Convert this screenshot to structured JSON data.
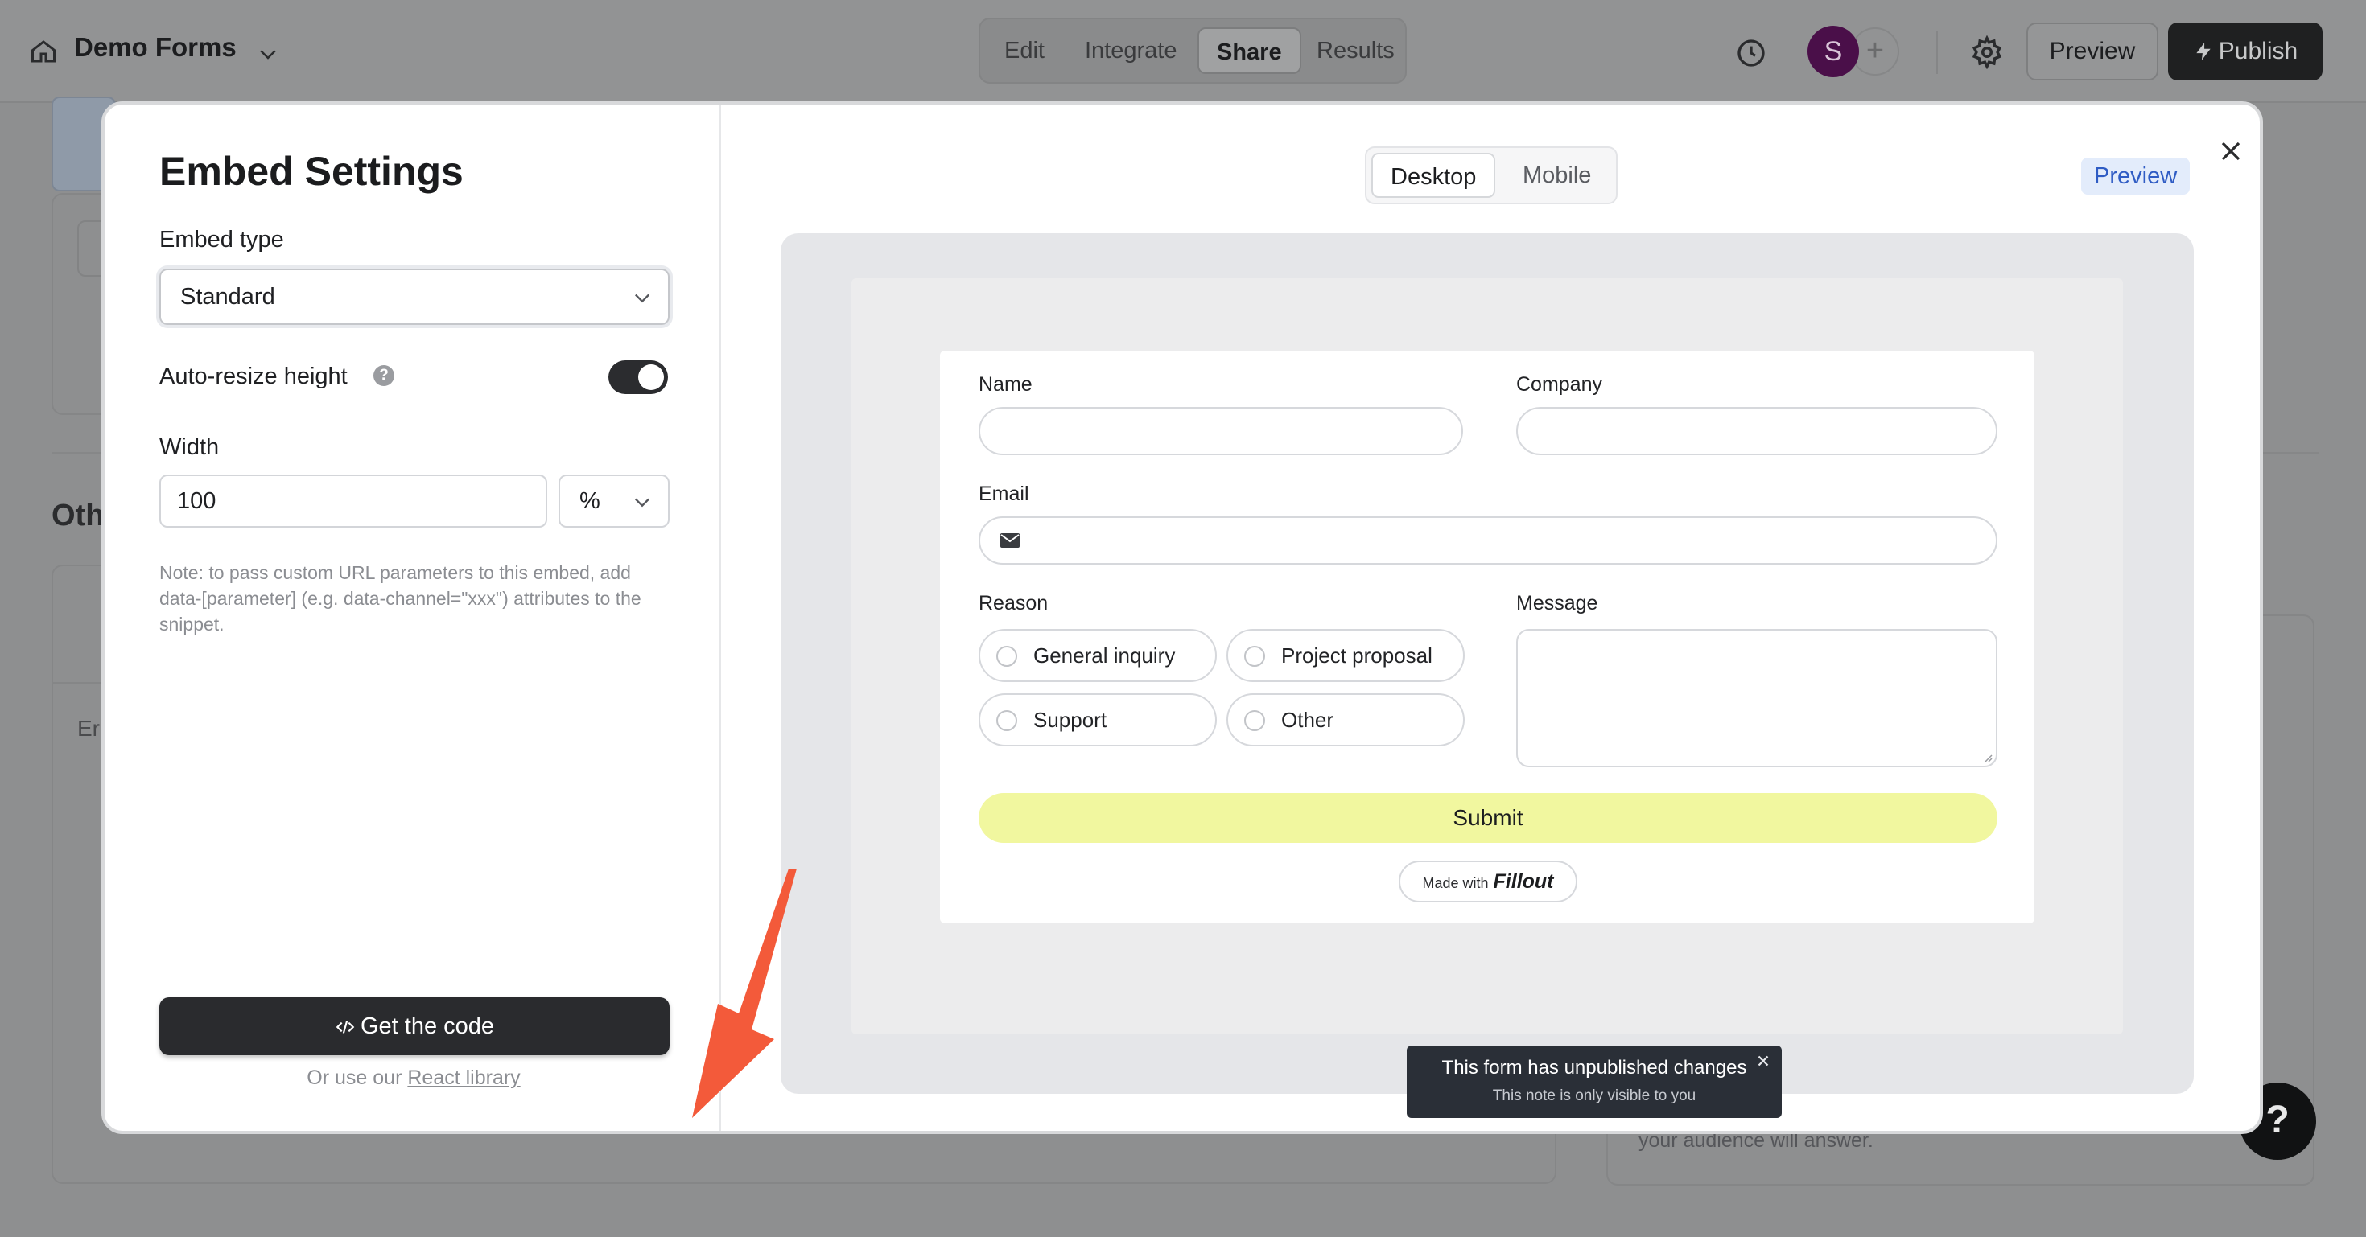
{
  "header": {
    "app_title": "Demo Forms",
    "tabs": [
      {
        "label": "Edit"
      },
      {
        "label": "Integrate"
      },
      {
        "label": "Share",
        "active": true
      },
      {
        "label": "Results"
      }
    ],
    "avatar_initial": "S",
    "add_user_symbol": "+",
    "preview_label": "Preview",
    "publish_label": "Publish",
    "icons": [
      "home-icon",
      "chevron-down-icon",
      "history-icon",
      "gear-icon",
      "lightning-icon"
    ]
  },
  "background": {
    "section_heading": "Oth",
    "card_text_1": "Er",
    "card_text_2": "your audience will answer.",
    "help_symbol": "?"
  },
  "modal": {
    "title": "Embed Settings",
    "embed_type_label": "Embed type",
    "embed_type_value": "Standard",
    "auto_resize_label": "Auto-resize height",
    "auto_resize_on": true,
    "width_label": "Width",
    "width_value": "100",
    "width_unit": "%",
    "note": "Note: to pass custom URL parameters to this embed, add data-[parameter] (e.g. data-channel=\"xxx\") attributes to the snippet.",
    "get_code_label": "Get the code",
    "react_prefix": "Or use our",
    "react_link": "React library",
    "view_tabs": [
      {
        "label": "Desktop",
        "active": true
      },
      {
        "label": "Mobile"
      }
    ],
    "preview_badge": "Preview"
  },
  "form_preview": {
    "name_label": "Name",
    "company_label": "Company",
    "email_label": "Email",
    "reason_label": "Reason",
    "message_label": "Message",
    "reason_options": [
      "General inquiry",
      "Project proposal",
      "Support",
      "Other"
    ],
    "submit_label": "Submit",
    "made_with": "Made with",
    "brand": "Fillout",
    "colors": {
      "submit_bg": "#f1f79f",
      "toast_bg": "#2a2f37",
      "accent_badge": "#2f5cc4"
    }
  },
  "toast": {
    "title": "This form has unpublished changes",
    "subtitle": "This note is only visible to you"
  }
}
